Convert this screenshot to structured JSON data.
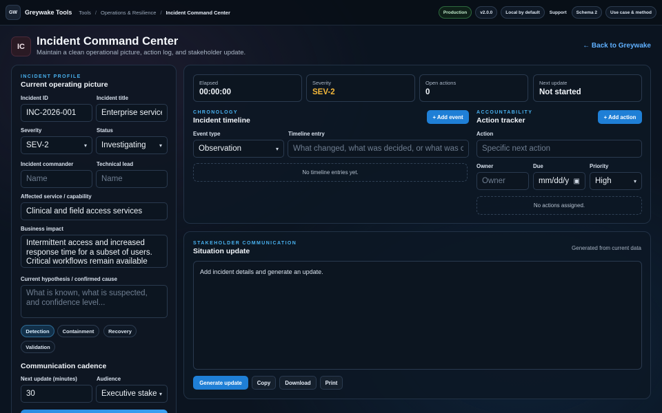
{
  "topbar": {
    "logo": "GW",
    "brand": "Greywake Tools",
    "crumbs": [
      "Tools",
      "Operations & Resilience",
      "Incident Command Center"
    ],
    "pills": [
      "Production",
      "v2.0.0",
      "Local by default",
      "Support",
      "Schema 2",
      "Use case & method"
    ],
    "accent_green": "#2d6a3e"
  },
  "header": {
    "badge": "IC",
    "title": "Incident Command Center",
    "subtitle": "Maintain a clean operational picture, action log, and stakeholder update.",
    "back": "← Back to Greywake"
  },
  "profile": {
    "eyebrow": "INCIDENT PROFILE",
    "title": "Current operating picture",
    "incident_id_label": "Incident ID",
    "incident_id": "INC-2026-001",
    "incident_title_label": "Incident title",
    "incident_title": "Enterprise service",
    "severity_label": "Severity",
    "severity": "SEV-2",
    "status_label": "Status",
    "status": "Investigating",
    "commander_label": "Incident commander",
    "commander_placeholder": "Name",
    "techlead_label": "Technical lead",
    "techlead_placeholder": "Name",
    "service_label": "Affected service / capability",
    "service": "Clinical and field access services",
    "impact_label": "Business impact",
    "impact": "Intermittent access and increased response time for a subset of users. Critical workflows remain available",
    "hypothesis_label": "Current hypothesis / confirmed cause",
    "hypothesis_placeholder": "What is known, what is suspected, and confidence level...",
    "phases": [
      "Detection",
      "Containment",
      "Recovery",
      "Validation"
    ],
    "cadence_title": "Communication cadence",
    "next_update_label": "Next update (minutes)",
    "next_update": "30",
    "audience_label": "Audience",
    "audience": "Executive stake"
  },
  "stats": [
    {
      "label": "Elapsed",
      "value": "00:00:00"
    },
    {
      "label": "Severity",
      "value": "SEV-2"
    },
    {
      "label": "Open actions",
      "value": "0"
    },
    {
      "label": "Next update",
      "value": "Not started"
    }
  ],
  "timeline": {
    "eyebrow": "CHRONOLOGY",
    "title": "Incident timeline",
    "add": "+ Add event",
    "event_type_label": "Event type",
    "event_type": "Observation",
    "entry_label": "Timeline entry",
    "entry_placeholder": "What changed, what was decided, or what was c",
    "empty": "No timeline entries yet."
  },
  "actions": {
    "eyebrow": "ACCOUNTABILITY",
    "title": "Action tracker",
    "add": "+ Add action",
    "action_label": "Action",
    "action_placeholder": "Specific next action",
    "owner_label": "Owner",
    "owner_placeholder": "Owner",
    "due_label": "Due",
    "due_placeholder": "mm/dd/y",
    "priority_label": "Priority",
    "priority": "High",
    "empty": "No actions assigned."
  },
  "comms": {
    "eyebrow": "STAKEHOLDER COMMUNICATION",
    "title": "Situation update",
    "note": "Generated from current data",
    "body": "Add incident details and generate an update.",
    "buttons": [
      "Generate update",
      "Copy",
      "Download",
      "Print"
    ]
  }
}
